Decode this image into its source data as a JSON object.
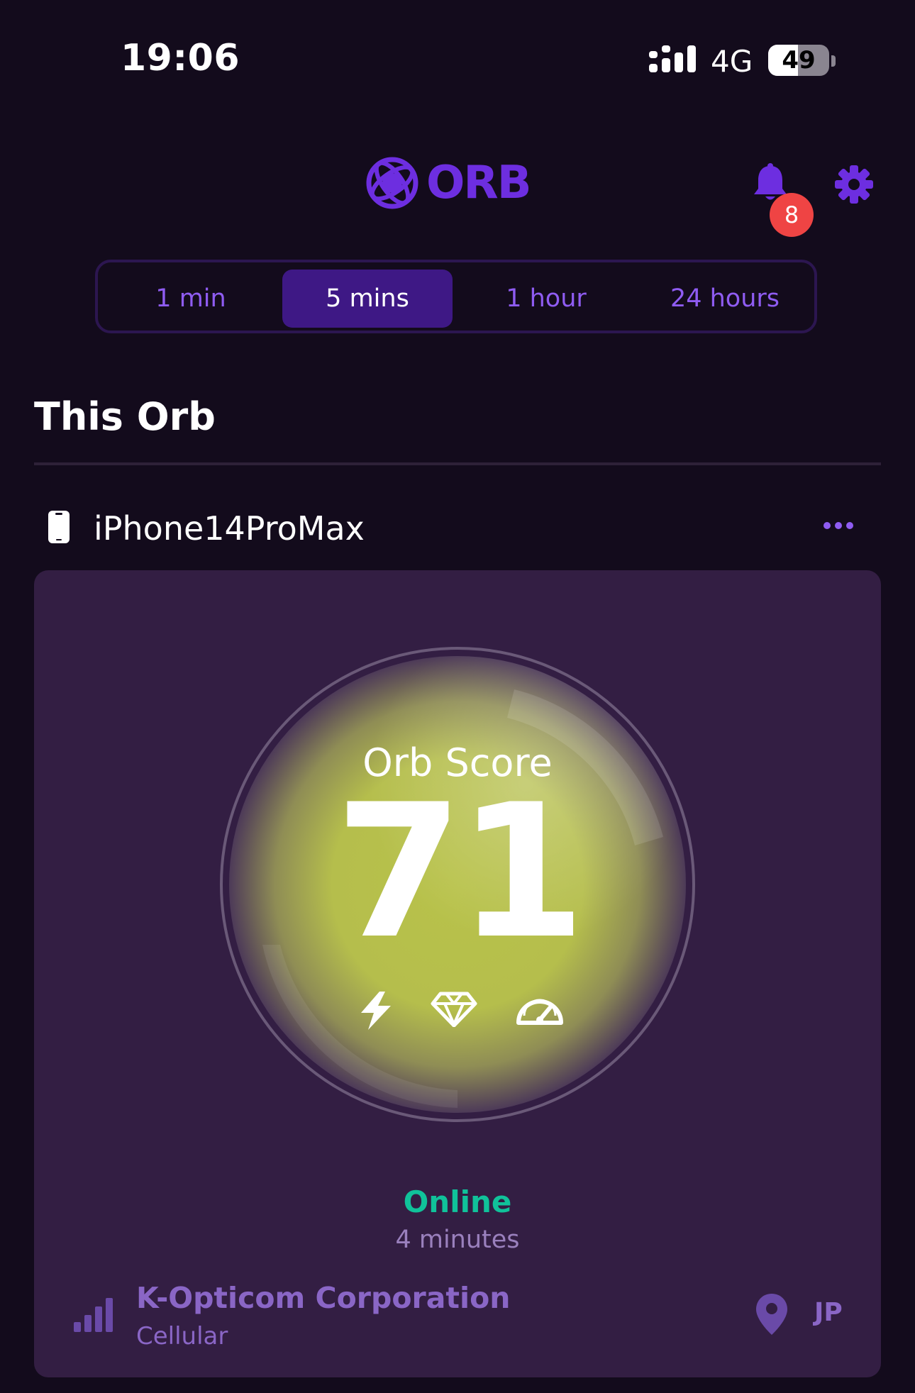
{
  "status_bar": {
    "time": "19:06",
    "network": "4G",
    "battery_percent": "49",
    "battery_level": 0.49
  },
  "header": {
    "logo_text": "ORB",
    "notification_count": "8",
    "brand_color": "#6d2ee0"
  },
  "time_range": {
    "options": [
      "1 min",
      "5 mins",
      "1 hour",
      "24 hours"
    ],
    "selected": "5 mins"
  },
  "section": {
    "title": "This Orb"
  },
  "device": {
    "name": "iPhone14ProMax",
    "icon": "smartphone-icon"
  },
  "orb": {
    "label": "Orb Score",
    "score": "71",
    "indicator_icons": [
      "bolt-icon",
      "diamond-icon",
      "gauge-icon"
    ],
    "color": "#b8c24a"
  },
  "connection": {
    "status": "Online",
    "status_color": "#10c29a",
    "duration": "4 minutes",
    "isp": "K-Opticom Corporation",
    "type": "Cellular",
    "country": "JP"
  }
}
